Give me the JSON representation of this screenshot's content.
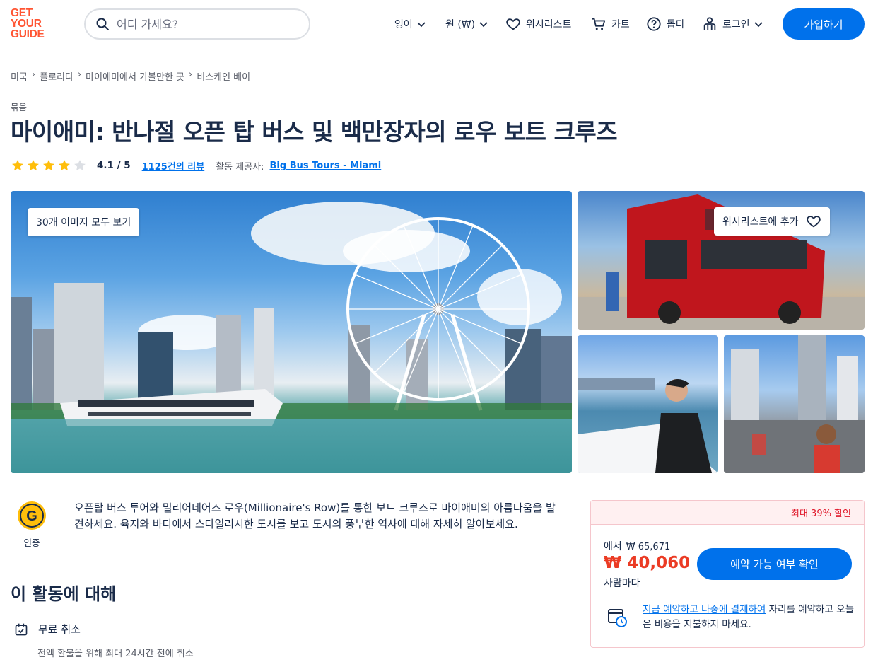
{
  "header": {
    "logo": [
      "GET",
      "YOUR",
      "GUIDE"
    ],
    "search_placeholder": "어디 가세요?",
    "language": "영어",
    "currency": "원 (₩)",
    "wishlist": "위시리스트",
    "cart": "카트",
    "help": "돕다",
    "login": "로그인",
    "signup": "가입하기"
  },
  "breadcrumb": [
    "미국",
    "플로리다",
    "마이애미에서 가볼만한 곳",
    "비스케인 베이"
  ],
  "category": "묶음",
  "title": "마이애미: 반나절 오픈 탑 버스 및 백만장자의 로우 보트 크루즈",
  "rating": {
    "stars": 4.1,
    "value": "4.1 / 5",
    "reviews": "1125건의 리뷰",
    "provider_label": "활동 제공자:",
    "provider": "Big Bus Tours - Miami"
  },
  "gallery": {
    "view_all": "30개 이미지 모두 보기",
    "add_wishlist": "위시리스트에 추가"
  },
  "badge": {
    "letter": "G",
    "label": "인증"
  },
  "description": "오픈탑 버스 투어와 밀리어네어즈 로우(Millionaire's Row)를 통한 보트 크루즈로 마이애미의 아름다움을 발견하세요. 육지와 바다에서 스타일리시한 도시를 보고 도시의 풍부한 역사에 대해 자세히 알아보세요.",
  "about": {
    "heading": "이 활동에 대해",
    "feature_title": "무료 취소",
    "feature_sub": "전액 환불을 위해 최대 24시간 전에 취소"
  },
  "booking": {
    "discount": "최대 39% 할인",
    "from_label": "에서",
    "old_price": "₩ 65,671",
    "price": "₩ 40,060",
    "per_person": "사람마다",
    "check_button": "예약 가능 여부 확인",
    "reserve_link": "지금 예약하고 나중에 결제하여",
    "reserve_text": " 자리를 예약하고 오늘은 비용을 지불하지 마세요."
  },
  "colors": {
    "brand": "#ff5533",
    "primary_button": "#0071eb",
    "price": "#eb3b24",
    "star": "#ffbe0b",
    "discount": "#e0192b"
  }
}
